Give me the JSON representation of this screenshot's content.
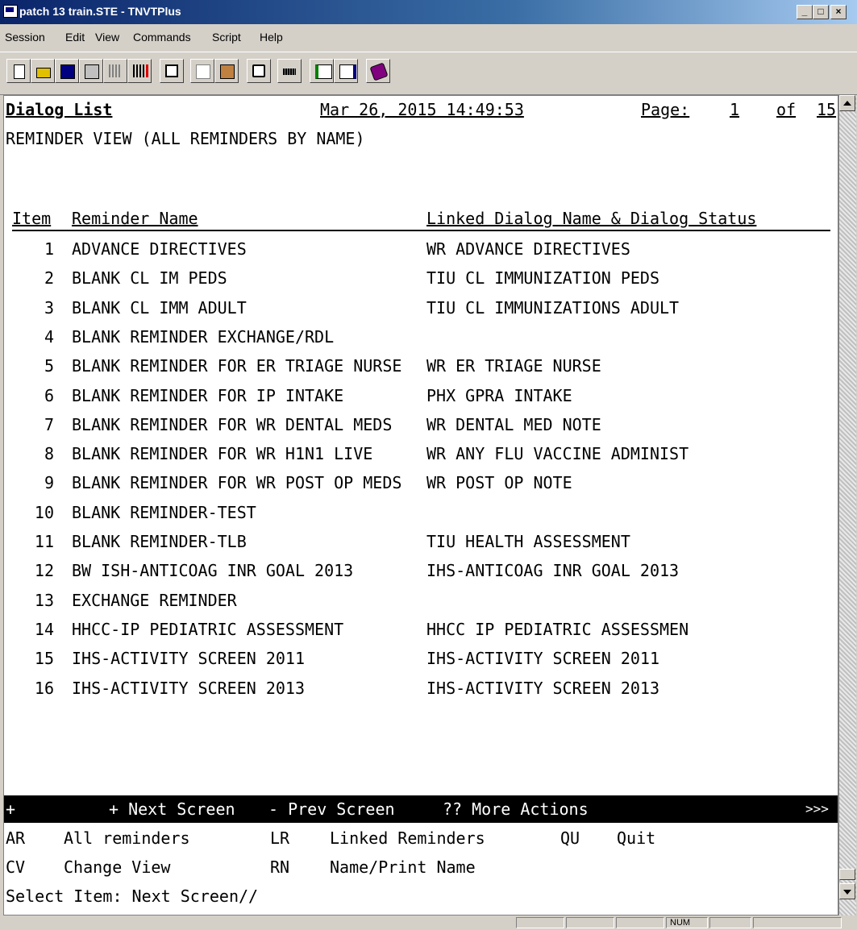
{
  "window": {
    "title": "patch 13 train.STE - TNVTPlus"
  },
  "menu": [
    "Session",
    "Edit",
    "View",
    "Commands",
    "Script",
    "Help"
  ],
  "header": {
    "title": "Dialog List",
    "date": "Mar 26, 2015 14:49:53",
    "page_label": "Page:",
    "page": "1",
    "of": "of",
    "total_pages": "15"
  },
  "view_title": "REMINDER VIEW (ALL REMINDERS BY NAME)",
  "columns": {
    "item": "Item",
    "reminder": "Reminder Name",
    "linked": "Linked Dialog Name & Dialog Status"
  },
  "rows": [
    {
      "num": "1",
      "name": "ADVANCE DIRECTIVES",
      "link": "WR ADVANCE DIRECTIVES"
    },
    {
      "num": "2",
      "name": "BLANK CL IM PEDS",
      "link": "TIU CL IMMUNIZATION PEDS"
    },
    {
      "num": "3",
      "name": "BLANK CL IMM ADULT",
      "link": "TIU CL IMMUNIZATIONS ADULT"
    },
    {
      "num": "4",
      "name": "BLANK REMINDER EXCHANGE/RDL",
      "link": ""
    },
    {
      "num": "5",
      "name": "BLANK REMINDER FOR ER TRIAGE NURSE",
      "link": "WR ER TRIAGE NURSE"
    },
    {
      "num": "6",
      "name": "BLANK REMINDER FOR IP INTAKE",
      "link": "PHX GPRA INTAKE"
    },
    {
      "num": "7",
      "name": "BLANK REMINDER FOR WR DENTAL MEDS",
      "link": "WR DENTAL MED NOTE"
    },
    {
      "num": "8",
      "name": "BLANK REMINDER FOR WR H1N1 LIVE",
      "link": "WR ANY FLU VACCINE ADMINIST"
    },
    {
      "num": "9",
      "name": "BLANK REMINDER FOR WR POST OP MEDS",
      "link": "WR POST OP NOTE"
    },
    {
      "num": "10",
      "name": "BLANK REMINDER-TEST",
      "link": ""
    },
    {
      "num": "11",
      "name": "BLANK REMINDER-TLB",
      "link": "TIU HEALTH ASSESSMENT"
    },
    {
      "num": "12",
      "name": "BW ISH-ANTICOAG INR GOAL 2013",
      "link": "IHS-ANTICOAG INR GOAL 2013"
    },
    {
      "num": "13",
      "name": "EXCHANGE REMINDER",
      "link": ""
    },
    {
      "num": "14",
      "name": "HHCC-IP PEDIATRIC ASSESSMENT",
      "link": "HHCC IP PEDIATRIC ASSESSMEN"
    },
    {
      "num": "15",
      "name": "IHS-ACTIVITY SCREEN 2011",
      "link": "IHS-ACTIVITY SCREEN 2011"
    },
    {
      "num": "16",
      "name": "IHS-ACTIVITY SCREEN 2013",
      "link": "IHS-ACTIVITY SCREEN 2013"
    }
  ],
  "actionbar": {
    "plus": "+",
    "next": "+ Next Screen",
    "prev": "- Prev Screen",
    "more": "?? More Actions",
    "arrows": ">>>"
  },
  "actions": [
    {
      "code": "AR",
      "label": "All reminders"
    },
    {
      "code": "LR",
      "label": "Linked Reminders"
    },
    {
      "code": "QU",
      "label": "Quit"
    },
    {
      "code": "CV",
      "label": "Change View"
    },
    {
      "code": "RN",
      "label": "Name/Print Name"
    }
  ],
  "prompt": "Select Item: Next Screen//",
  "status": {
    "num": "NUM"
  },
  "toolbar_icons": [
    "new-icon",
    "open-icon",
    "save-icon",
    "properties-icon",
    "connect-icon",
    "disconnect-icon",
    "print-icon",
    "copy-icon",
    "paste-icon",
    "screen-icon",
    "keyboard-icon",
    "receive-icon",
    "send-icon",
    "script-icon"
  ]
}
